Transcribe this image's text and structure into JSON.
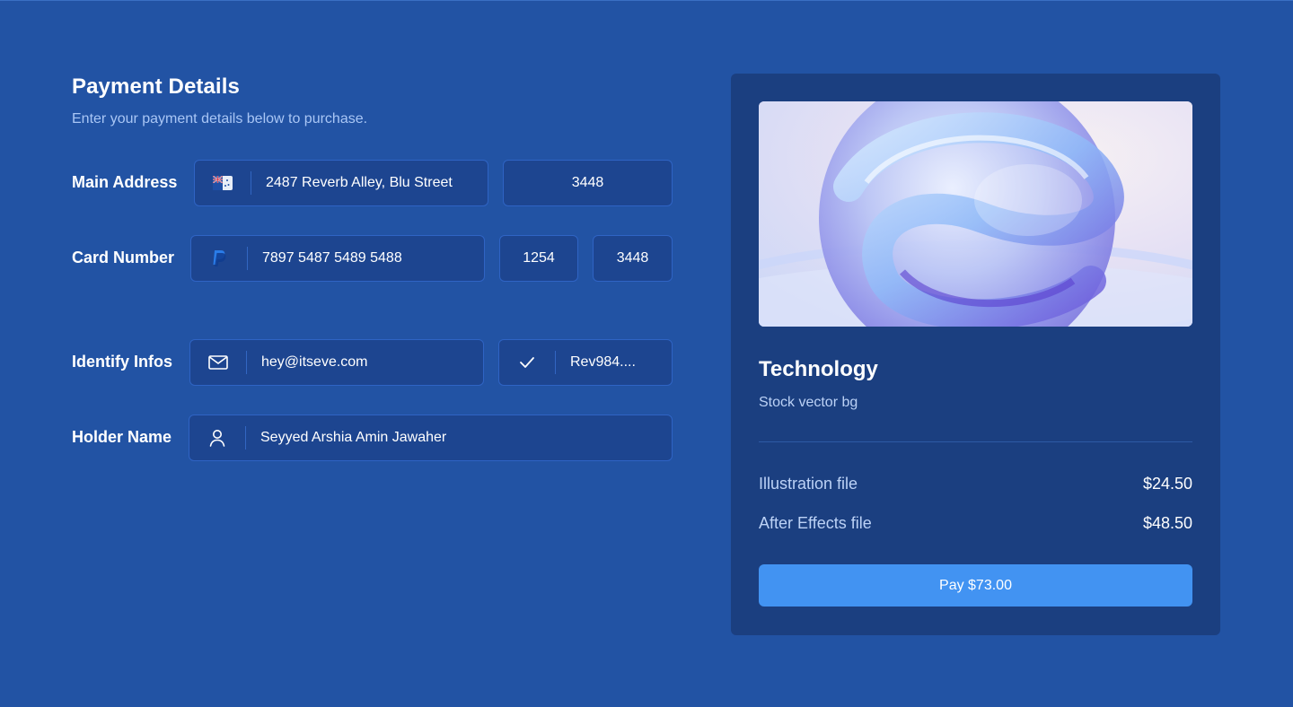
{
  "header": {
    "title": "Payment Details",
    "subtitle": "Enter your payment details below to purchase."
  },
  "form": {
    "main_address": {
      "label": "Main Address",
      "icon": "flag-icon",
      "address": "2487 Reverb Alley, Blu Street",
      "postal_code": "3448"
    },
    "card_number": {
      "label": "Card Number",
      "icon": "paypal-icon",
      "number": "7897 5487 5489 5488",
      "expiry": "1254",
      "cvc": "3448"
    },
    "identify_infos": {
      "label": "Identify Infos",
      "email_icon": "mail-icon",
      "email": "hey@itseve.com",
      "code_icon": "check-icon",
      "code": "Rev984...."
    },
    "holder_name": {
      "label": "Holder Name",
      "icon": "user-icon",
      "name": "Seyyed Arshia Amin Jawaher"
    }
  },
  "summary": {
    "product_title": "Technology",
    "product_subtitle": "Stock vector bg",
    "items": [
      {
        "name": "Illustration file",
        "price": "$24.50"
      },
      {
        "name": "After Effects file",
        "price": "$48.50"
      }
    ],
    "pay_label": "Pay $73.00"
  },
  "colors": {
    "background": "#2253a4",
    "field_bg": "#1d4590",
    "card_bg": "#1b3f80",
    "accent": "#4293f2"
  }
}
